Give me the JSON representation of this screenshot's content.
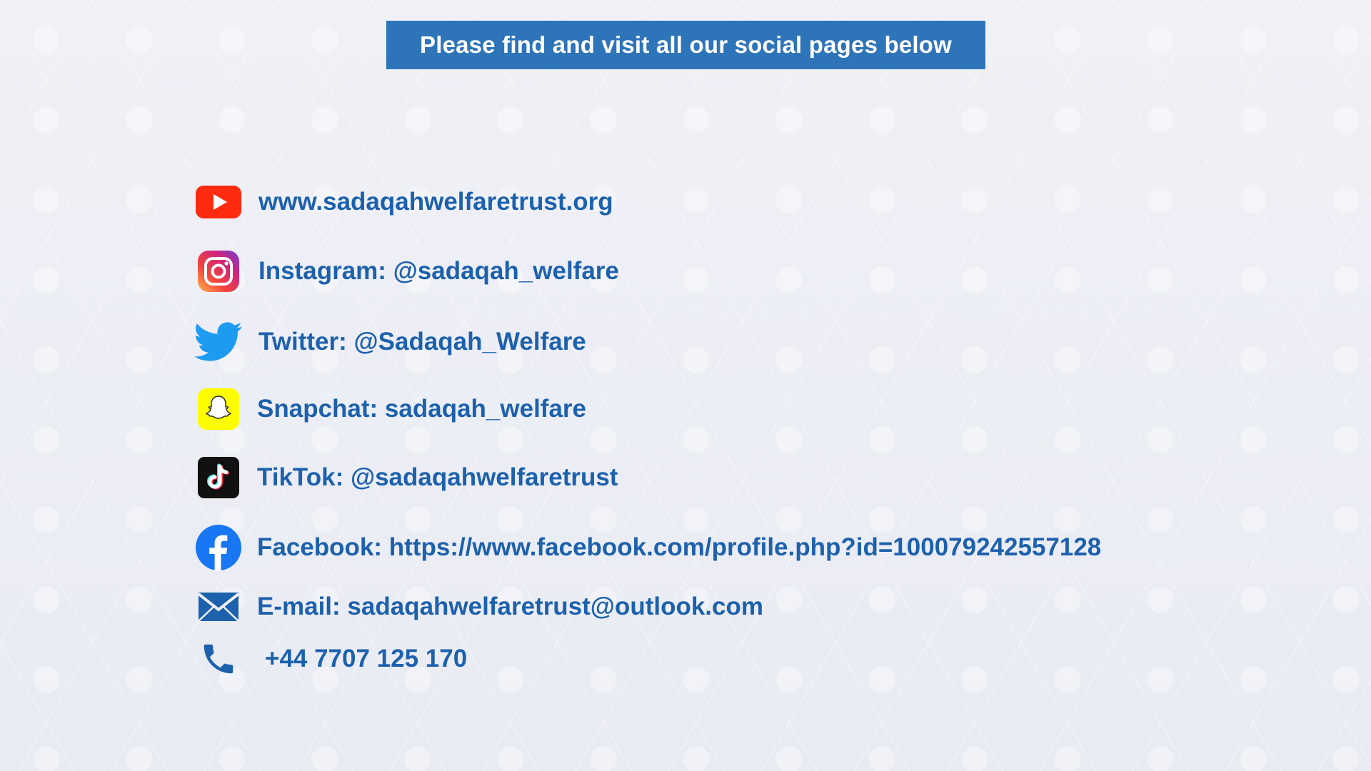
{
  "banner": {
    "text": "Please find and visit all our social pages below"
  },
  "contacts": [
    {
      "icon": "youtube-icon",
      "text": "www.sadaqahwelfaretrust.org"
    },
    {
      "icon": "instagram-icon",
      "text": "Instagram: @sadaqah_welfare"
    },
    {
      "icon": "twitter-icon",
      "text": "Twitter: @Sadaqah_Welfare"
    },
    {
      "icon": "snapchat-icon",
      "text": "Snapchat: sadaqah_welfare"
    },
    {
      "icon": "tiktok-icon",
      "text": "TikTok: @sadaqahwelfaretrust"
    },
    {
      "icon": "facebook-icon",
      "text": "Facebook: https://www.facebook.com/profile.php?id=100079242557128"
    },
    {
      "icon": "email-icon",
      "text": "E-mail: sadaqahwelfaretrust@outlook.com"
    },
    {
      "icon": "phone-icon",
      "text": "+44 7707 125 170"
    }
  ],
  "colors": {
    "banner_bg": "#2e74b8",
    "text": "#1d61ad",
    "background": "#eef0f6"
  }
}
